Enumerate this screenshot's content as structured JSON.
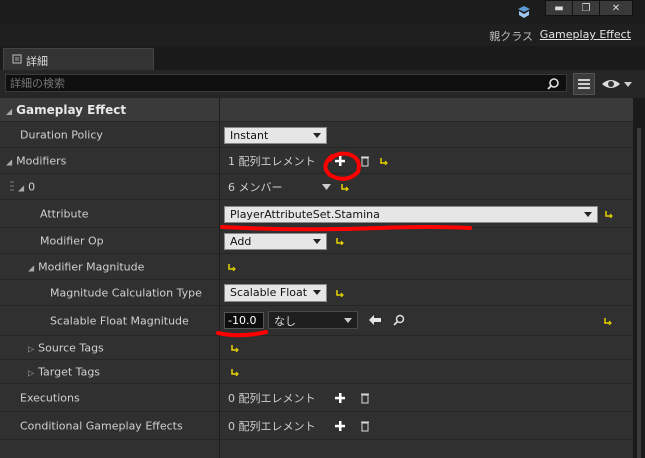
{
  "window": {
    "minimize_glyph": "▬",
    "restore_glyph": "❐",
    "close_glyph": "✕"
  },
  "parent_class": {
    "label": "親クラス",
    "value": "Gameplay Effect"
  },
  "tab": {
    "label": "詳細"
  },
  "search": {
    "placeholder": "詳細の検索"
  },
  "sections": {
    "category": "Gameplay Effect",
    "duration_policy": {
      "label": "Duration Policy",
      "value": "Instant"
    },
    "modifiers": {
      "label": "Modifiers",
      "value": "1 配列エレメント"
    },
    "index0": {
      "label": "0",
      "value": "6 メンバー"
    },
    "attribute": {
      "label": "Attribute",
      "value": "PlayerAttributeSet.Stamina"
    },
    "modifier_op": {
      "label": "Modifier Op",
      "value": "Add"
    },
    "modifier_magnitude": {
      "label": "Modifier Magnitude"
    },
    "magnitude_calc": {
      "label": "Magnitude Calculation Type",
      "value": "Scalable Float"
    },
    "scalable_float": {
      "label": "Scalable Float Magnitude",
      "value": "-10.0",
      "curve": "なし"
    },
    "source_tags": {
      "label": "Source Tags"
    },
    "target_tags": {
      "label": "Target Tags"
    },
    "executions": {
      "label": "Executions",
      "value": "0 配列エレメント"
    },
    "conditional": {
      "label": "Conditional Gameplay Effects",
      "value": "0 配列エレメント"
    }
  },
  "colors": {
    "panel": "#303030",
    "annotation": "#ff0000",
    "reset_arrow": "#e8d400"
  }
}
